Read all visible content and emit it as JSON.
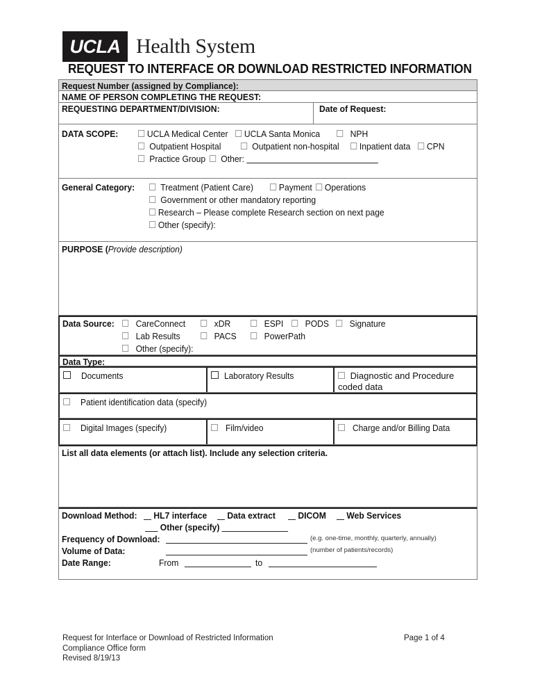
{
  "header": {
    "logo_box": "UCLA",
    "logo_text": "Health System",
    "title": "REQUEST TO INTERFACE OR DOWNLOAD RESTRICTED INFORMATION"
  },
  "fields": {
    "request_number": "Request Number (assigned by Compliance):",
    "name_of_person": "NAME OF PERSON COMPLETING THE REQUEST:",
    "department": "REQUESTING DEPARTMENT/DIVISION:",
    "date_of_request": "Date of Request:"
  },
  "data_scope": {
    "label": "DATA SCOPE:",
    "options": [
      "UCLA Medical Center",
      "UCLA Santa Monica",
      "NPH",
      "Outpatient Hospital",
      "Outpatient non-hospital",
      "Inpatient data",
      "CPN",
      "Practice Group",
      "Other:"
    ]
  },
  "general_category": {
    "label": "General Category:",
    "options": [
      "Treatment (Patient Care)",
      "Payment",
      "Operations",
      "Government or other mandatory reporting",
      "Research – Please complete Research section on next page",
      "Other (specify):"
    ]
  },
  "purpose": {
    "label": "PURPOSE (",
    "hint": "Provide description)"
  },
  "data_source": {
    "label": "Data Source:",
    "options": [
      "CareConnect",
      "xDR",
      "ESPI",
      "PODS",
      "Signature",
      "Lab Results",
      "PACS",
      "PowerPath",
      "Other (specify):"
    ]
  },
  "data_type": {
    "label": "Data Type:",
    "options": [
      "Documents",
      "Laboratory Results",
      "Diagnostic and Procedure coded data",
      "Patient identification data (specify)",
      "Digital Images (specify)",
      "Film/video",
      "Charge  and/or Billing Data"
    ]
  },
  "data_elements": {
    "label": "List all data elements (or attach list).  Include any selection criteria."
  },
  "download": {
    "method_label": "Download Method:",
    "methods": [
      "HL7 interface",
      "Data extract",
      "DICOM",
      "Web Services",
      "Other (specify)"
    ],
    "frequency_label": "Frequency of Download:",
    "frequency_hint": "(e.g. one-time, monthly, quarterly, annually)",
    "volume_label": "Volume of Data:",
    "volume_hint": "(number of patients/records)",
    "date_range_label": "Date Range:",
    "from_label": "From",
    "to_label": "to"
  },
  "footer": {
    "line1": "Request for Interface or Download of Restricted Information",
    "line2": "Compliance Office form",
    "line3": "Revised 8/19/13",
    "page": "Page 1 of 4"
  }
}
